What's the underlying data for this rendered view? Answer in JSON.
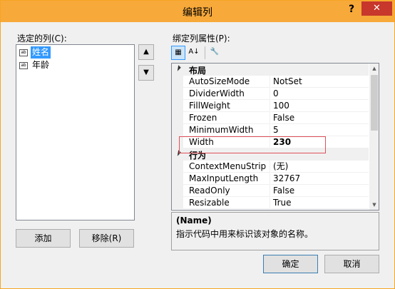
{
  "window": {
    "title": "编辑列",
    "help_label": "?",
    "close_label": "✕",
    "accent_color": "#f7a93a"
  },
  "left": {
    "label": "选定的列(C):",
    "items": [
      {
        "icon": "ab",
        "label": "姓名",
        "selected": true
      },
      {
        "icon": "ab",
        "label": "年龄",
        "selected": false
      }
    ],
    "move_up_icon": "▲",
    "move_down_icon": "▼",
    "add_label": "添加",
    "remove_label": "移除(R)"
  },
  "right": {
    "label": "绑定列属性(P):",
    "toolbar": {
      "categorized_icon": "▦",
      "alphabetical_icon": "A↓",
      "property_pages_icon": "🔧"
    },
    "categories": [
      {
        "name": "布局",
        "properties": [
          {
            "name": "AutoSizeMode",
            "value": "NotSet"
          },
          {
            "name": "DividerWidth",
            "value": "0"
          },
          {
            "name": "FillWeight",
            "value": "100"
          },
          {
            "name": "Frozen",
            "value": "False"
          },
          {
            "name": "MinimumWidth",
            "value": "5"
          },
          {
            "name": "Width",
            "value": "230"
          }
        ]
      },
      {
        "name": "行为",
        "properties": [
          {
            "name": "ContextMenuStrip",
            "value": "(无)"
          },
          {
            "name": "MaxInputLength",
            "value": "32767"
          },
          {
            "name": "ReadOnly",
            "value": "False"
          },
          {
            "name": "Resizable",
            "value": "True"
          }
        ]
      }
    ],
    "description": {
      "title": "(Name)",
      "text": "指示代码中用来标识该对象的名称。"
    }
  },
  "footer": {
    "ok_label": "确定",
    "cancel_label": "取消"
  }
}
